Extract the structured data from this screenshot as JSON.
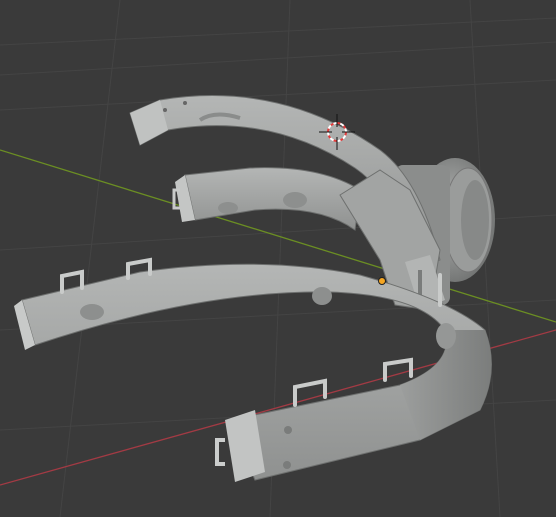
{
  "viewport": {
    "background": "#3a3a3a",
    "grid_color": "#444444",
    "x_axis_color": "#a33a44",
    "y_axis_color": "#6b8e23",
    "mesh_color": "#a5a7a6",
    "mesh_shadow": "#7d7f7e",
    "origin_color": "#f5a623",
    "cursor_color": "#e23a3a"
  },
  "icons": {
    "cursor": "3d-cursor-icon",
    "origin": "object-origin-icon"
  }
}
